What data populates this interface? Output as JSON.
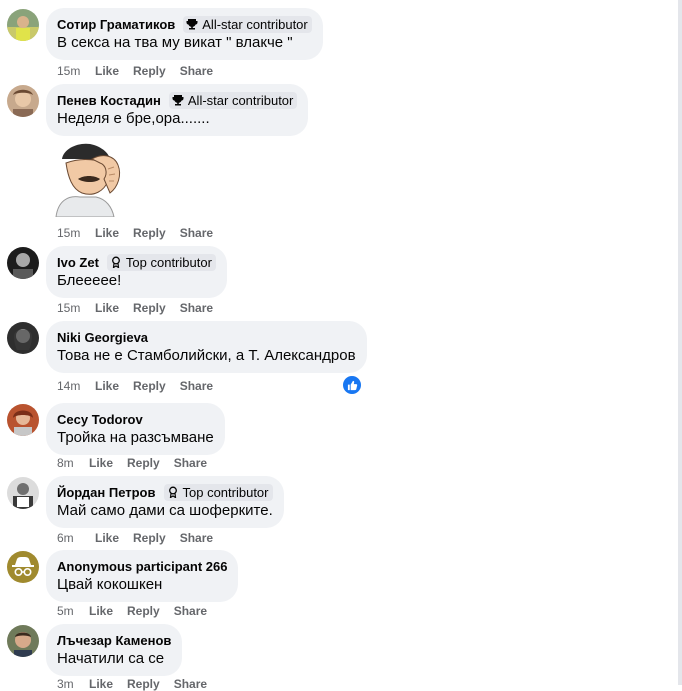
{
  "badges": {
    "all_star": "All-star contributor",
    "top": "Top contributor"
  },
  "actions": {
    "like": "Like",
    "reply": "Reply",
    "share": "Share"
  },
  "comments": [
    {
      "author": "Сотир Граматиков",
      "badge": "All-star contributor",
      "text": "В секса на тва му викат \" влакче \"",
      "time": "15m"
    },
    {
      "author": "Пенев Костадин",
      "badge": "All-star contributor",
      "text": "Неделя е бре,ора.......",
      "time": "15m"
    },
    {
      "author": "Ivo Zet",
      "badge": "Top contributor",
      "text": "Блеееее!",
      "time": "15m"
    },
    {
      "author": "Niki Georgieva",
      "badge": "",
      "text": "Това не е Стамболийски, а Т. Александров",
      "time": "14m"
    },
    {
      "author": "Cecy Todorov",
      "badge": "",
      "text": "Тройка на разсъмване",
      "time": "8m"
    },
    {
      "author": "Йордан Петров",
      "badge": "Top contributor",
      "text": "Май само дами са шоферките.",
      "time": "6m"
    },
    {
      "author": "Anonymous participant 266",
      "badge": "",
      "text": "Цвай кокошкен",
      "time": "5m"
    },
    {
      "author": "Лъчезар Каменов",
      "badge": "",
      "text": "Начатили са се",
      "time": "3m"
    }
  ],
  "colors": {
    "bubble": "#f0f2f5",
    "meta": "#65676b",
    "like_blue": "#1877f2"
  },
  "icons": {
    "all_star": "trophy-icon",
    "top": "ribbon-icon",
    "reaction": "like-reaction-icon"
  }
}
